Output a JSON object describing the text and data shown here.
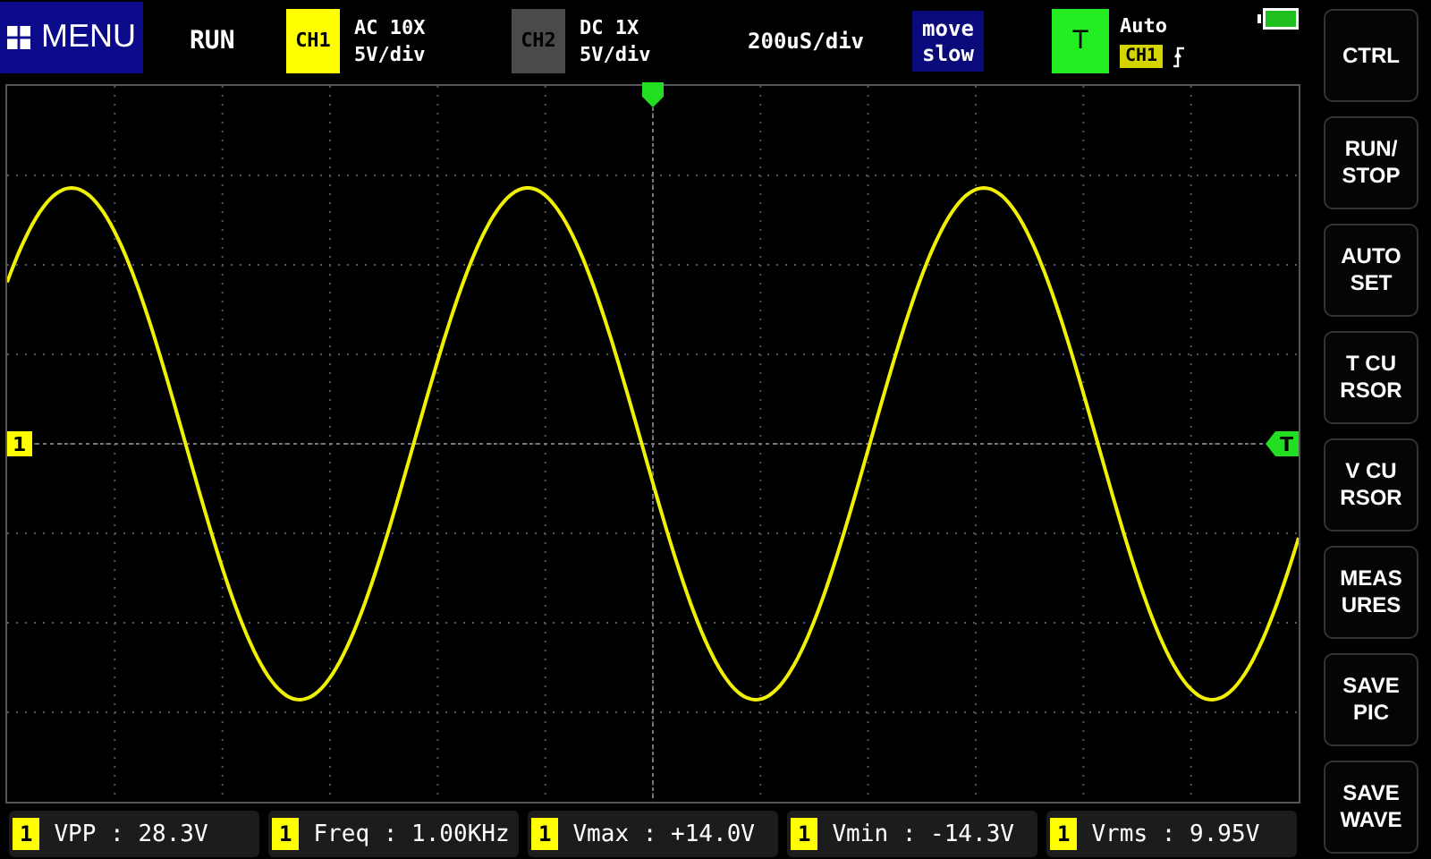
{
  "top_bar": {
    "menu": {
      "label": "MENU"
    },
    "run_state": "RUN",
    "channels": [
      {
        "label": "CH1",
        "coupling": "AC 10X",
        "scale": "5V/div",
        "active": true
      },
      {
        "label": "CH2",
        "coupling": "DC 1X",
        "scale": "5V/div",
        "active": false
      }
    ],
    "timebase": "200uS/div",
    "move_speed": [
      "move",
      "slow"
    ],
    "trigger": {
      "label": "T",
      "mode": "Auto",
      "source": "CH1"
    }
  },
  "side_buttons": [
    [
      "CTRL"
    ],
    [
      "RUN/",
      "STOP"
    ],
    [
      "AUTO",
      "SET"
    ],
    [
      "T CU",
      "RSOR"
    ],
    [
      "V CU",
      "RSOR"
    ],
    [
      "MEAS",
      "URES"
    ],
    [
      "SAVE",
      "PIC"
    ],
    [
      "SAVE",
      "WAVE"
    ]
  ],
  "markers": {
    "channel": "1",
    "trigger_level": "T"
  },
  "measurements": [
    {
      "channel": "1",
      "text": "VPP : 28.3V"
    },
    {
      "channel": "1",
      "text": "Freq : 1.00KHz"
    },
    {
      "channel": "1",
      "text": "Vmax : +14.0V"
    },
    {
      "channel": "1",
      "text": "Vmin : -14.3V"
    },
    {
      "channel": "1",
      "text": "Vrms : 9.95V"
    }
  ]
}
